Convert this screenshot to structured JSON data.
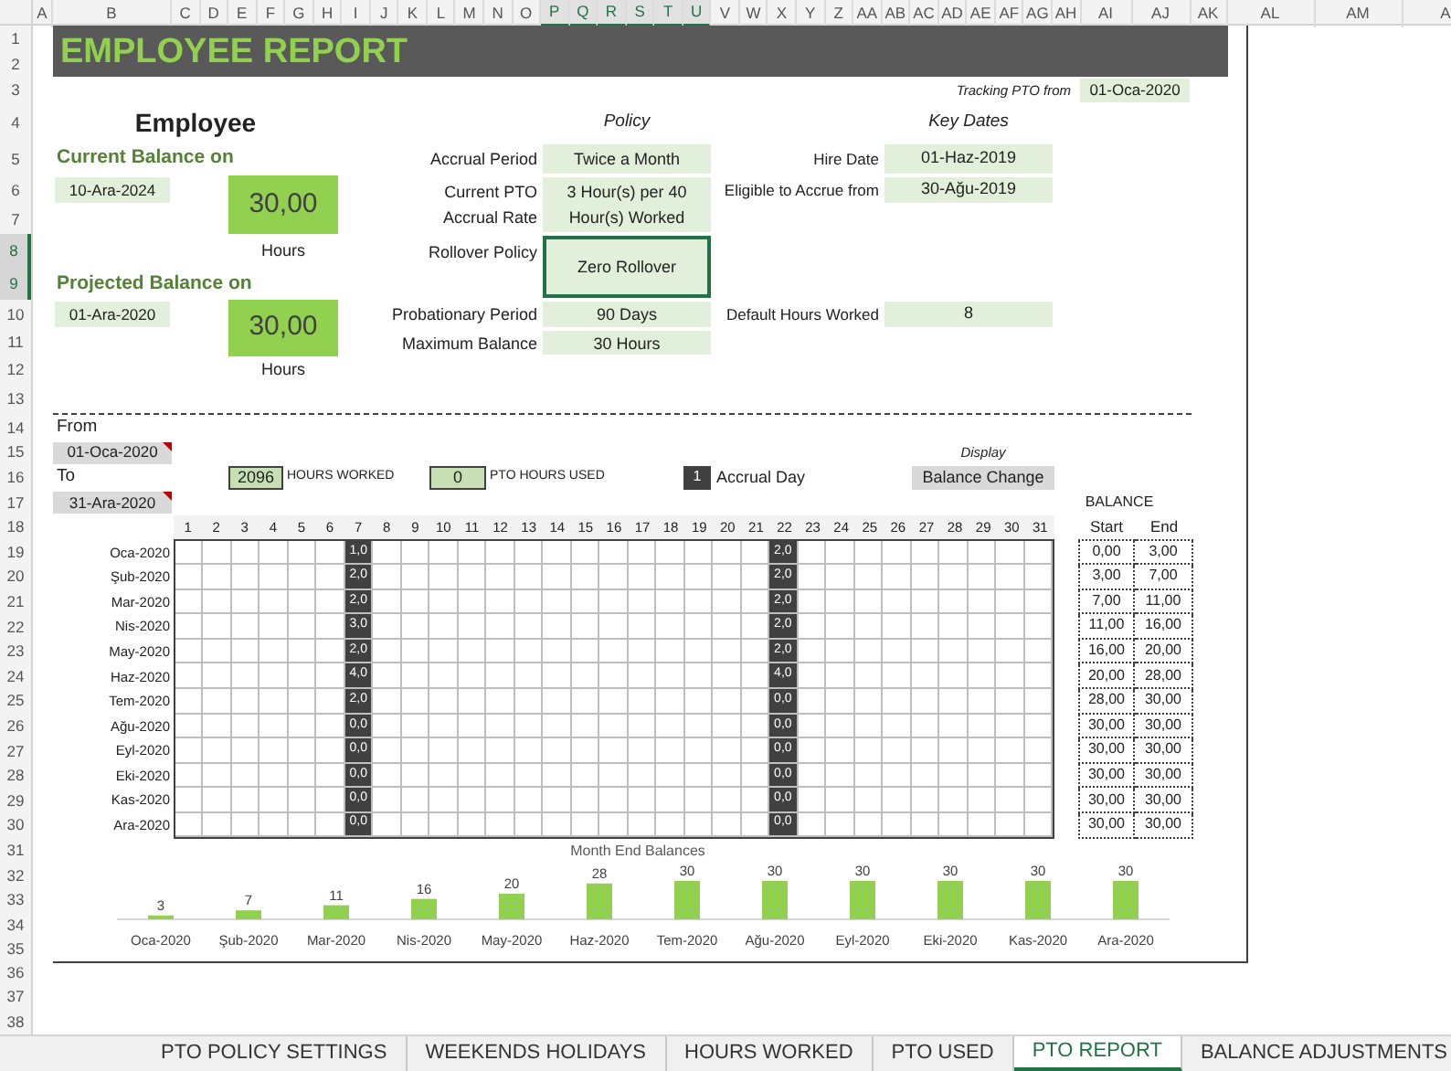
{
  "column_headers": [
    {
      "label": "A",
      "selected": false
    },
    {
      "label": "B",
      "selected": false
    },
    {
      "label": "C",
      "selected": false
    },
    {
      "label": "D",
      "selected": false
    },
    {
      "label": "E",
      "selected": false
    },
    {
      "label": "F",
      "selected": false
    },
    {
      "label": "G",
      "selected": false
    },
    {
      "label": "H",
      "selected": false
    },
    {
      "label": "I",
      "selected": false
    },
    {
      "label": "J",
      "selected": false
    },
    {
      "label": "K",
      "selected": false
    },
    {
      "label": "L",
      "selected": false
    },
    {
      "label": "M",
      "selected": false
    },
    {
      "label": "N",
      "selected": false
    },
    {
      "label": "O",
      "selected": false
    },
    {
      "label": "P",
      "selected": true
    },
    {
      "label": "Q",
      "selected": true
    },
    {
      "label": "R",
      "selected": true
    },
    {
      "label": "S",
      "selected": true
    },
    {
      "label": "T",
      "selected": true
    },
    {
      "label": "U",
      "selected": true
    },
    {
      "label": "V",
      "selected": false
    },
    {
      "label": "W",
      "selected": false
    },
    {
      "label": "X",
      "selected": false
    },
    {
      "label": "Y",
      "selected": false
    },
    {
      "label": "Z",
      "selected": false
    },
    {
      "label": "AA",
      "selected": false
    },
    {
      "label": "AB",
      "selected": false
    },
    {
      "label": "AC",
      "selected": false
    },
    {
      "label": "AD",
      "selected": false
    },
    {
      "label": "AE",
      "selected": false
    },
    {
      "label": "AF",
      "selected": false
    },
    {
      "label": "AG",
      "selected": false
    },
    {
      "label": "AH",
      "selected": false
    },
    {
      "label": "AI",
      "selected": false
    },
    {
      "label": "AJ",
      "selected": false
    },
    {
      "label": "AK",
      "selected": false
    },
    {
      "label": "AL",
      "selected": false
    },
    {
      "label": "AM",
      "selected": false
    },
    {
      "label": "A",
      "selected": false
    }
  ],
  "row_headers": [
    {
      "label": "1",
      "selected": false
    },
    {
      "label": "2",
      "selected": false
    },
    {
      "label": "3",
      "selected": false
    },
    {
      "label": "4",
      "selected": false
    },
    {
      "label": "5",
      "selected": false
    },
    {
      "label": "6",
      "selected": false
    },
    {
      "label": "7",
      "selected": false
    },
    {
      "label": "8",
      "selected": true
    },
    {
      "label": "9",
      "selected": true
    },
    {
      "label": "10",
      "selected": false
    },
    {
      "label": "11",
      "selected": false
    },
    {
      "label": "12",
      "selected": false
    },
    {
      "label": "13",
      "selected": false
    },
    {
      "label": "14",
      "selected": false
    },
    {
      "label": "15",
      "selected": false
    },
    {
      "label": "16",
      "selected": false
    },
    {
      "label": "17",
      "selected": false
    },
    {
      "label": "18",
      "selected": false
    },
    {
      "label": "19",
      "selected": false
    },
    {
      "label": "20",
      "selected": false
    },
    {
      "label": "21",
      "selected": false
    },
    {
      "label": "22",
      "selected": false
    },
    {
      "label": "23",
      "selected": false
    },
    {
      "label": "24",
      "selected": false
    },
    {
      "label": "25",
      "selected": false
    },
    {
      "label": "26",
      "selected": false
    },
    {
      "label": "27",
      "selected": false
    },
    {
      "label": "28",
      "selected": false
    },
    {
      "label": "29",
      "selected": false
    },
    {
      "label": "30",
      "selected": false
    },
    {
      "label": "31",
      "selected": false
    },
    {
      "label": "32",
      "selected": false
    },
    {
      "label": "33",
      "selected": false
    },
    {
      "label": "34",
      "selected": false
    },
    {
      "label": "35",
      "selected": false
    },
    {
      "label": "36",
      "selected": false
    },
    {
      "label": "37",
      "selected": false
    },
    {
      "label": "38",
      "selected": false
    }
  ],
  "report": {
    "title": "EMPLOYEE REPORT",
    "tracking": {
      "label": "Tracking PTO from",
      "value": "01-Oca-2020"
    },
    "employee": {
      "heading": "Employee",
      "balances": [
        {
          "label": "Current Balance on",
          "date": "10-Ara-2024",
          "value": "30,00",
          "unit": "Hours"
        },
        {
          "label": "Projected Balance on",
          "date": "01-Ara-2020",
          "value": "30,00",
          "unit": "Hours"
        }
      ]
    },
    "policy": {
      "heading": "Policy",
      "items": [
        {
          "label": "Accrual Period",
          "value": "Twice a Month",
          "selected": false
        },
        {
          "label": "Current PTO Accrual Rate",
          "value": "3 Hour(s) per 40 Hour(s) Worked",
          "selected": false
        },
        {
          "label": "Rollover Policy",
          "value": "Zero Rollover",
          "selected": true
        },
        {
          "label": "Probationary Period",
          "value": "90 Days",
          "selected": false
        },
        {
          "label": "Maximum Balance",
          "value": "30 Hours",
          "selected": false
        }
      ]
    },
    "key_dates": {
      "heading": "Key Dates",
      "items": [
        {
          "label": "Hire Date",
          "value": "01-Haz-2019"
        },
        {
          "label": "Eligible to Accrue from",
          "value": "30-Ağu-2019"
        },
        {
          "label": "Default Hours Worked",
          "value": "8"
        }
      ]
    },
    "period": {
      "from_label": "From",
      "from": "01-Oca-2020",
      "to_label": "To",
      "to": "31-Ara-2020"
    },
    "summary": {
      "hours_worked": "2096",
      "hours_worked_label": "HOURS WORKED",
      "pto_used": "0",
      "pto_used_label": "PTO HOURS USED",
      "accrual_key": "1",
      "accrual_key_label": "Accrual Day",
      "display_label": "Display",
      "display_value": "Balance Change"
    },
    "balance": {
      "heading": "BALANCE",
      "start_label": "Start",
      "end_label": "End"
    },
    "calendar": {
      "days": [
        {
          "label": "1",
          "accrual": false
        },
        {
          "label": "2",
          "accrual": false
        },
        {
          "label": "3",
          "accrual": false
        },
        {
          "label": "4",
          "accrual": false
        },
        {
          "label": "5",
          "accrual": false
        },
        {
          "label": "6",
          "accrual": false
        },
        {
          "label": "7",
          "accrual": true
        },
        {
          "label": "8",
          "accrual": false
        },
        {
          "label": "9",
          "accrual": false
        },
        {
          "label": "10",
          "accrual": false
        },
        {
          "label": "11",
          "accrual": false
        },
        {
          "label": "12",
          "accrual": false
        },
        {
          "label": "13",
          "accrual": false
        },
        {
          "label": "14",
          "accrual": false
        },
        {
          "label": "15",
          "accrual": false
        },
        {
          "label": "16",
          "accrual": false
        },
        {
          "label": "17",
          "accrual": false
        },
        {
          "label": "18",
          "accrual": false
        },
        {
          "label": "19",
          "accrual": false
        },
        {
          "label": "20",
          "accrual": false
        },
        {
          "label": "21",
          "accrual": false
        },
        {
          "label": "22",
          "accrual": true
        },
        {
          "label": "23",
          "accrual": false
        },
        {
          "label": "24",
          "accrual": false
        },
        {
          "label": "25",
          "accrual": false
        },
        {
          "label": "26",
          "accrual": false
        },
        {
          "label": "27",
          "accrual": false
        },
        {
          "label": "28",
          "accrual": false
        },
        {
          "label": "29",
          "accrual": false
        },
        {
          "label": "30",
          "accrual": false
        },
        {
          "label": "31",
          "accrual": false
        }
      ],
      "months": [
        {
          "label": "Oca-2020",
          "accruals": [
            "1,0",
            "2,0"
          ],
          "start": "0,00",
          "end": "3,00"
        },
        {
          "label": "Şub-2020",
          "accruals": [
            "2,0",
            "2,0"
          ],
          "start": "3,00",
          "end": "7,00"
        },
        {
          "label": "Mar-2020",
          "accruals": [
            "2,0",
            "2,0"
          ],
          "start": "7,00",
          "end": "11,00"
        },
        {
          "label": "Nis-2020",
          "accruals": [
            "3,0",
            "2,0"
          ],
          "start": "11,00",
          "end": "16,00"
        },
        {
          "label": "May-2020",
          "accruals": [
            "2,0",
            "2,0"
          ],
          "start": "16,00",
          "end": "20,00"
        },
        {
          "label": "Haz-2020",
          "accruals": [
            "4,0",
            "4,0"
          ],
          "start": "20,00",
          "end": "28,00"
        },
        {
          "label": "Tem-2020",
          "accruals": [
            "2,0",
            "0,0"
          ],
          "start": "28,00",
          "end": "30,00"
        },
        {
          "label": "Ağu-2020",
          "accruals": [
            "0,0",
            "0,0"
          ],
          "start": "30,00",
          "end": "30,00"
        },
        {
          "label": "Eyl-2020",
          "accruals": [
            "0,0",
            "0,0"
          ],
          "start": "30,00",
          "end": "30,00"
        },
        {
          "label": "Eki-2020",
          "accruals": [
            "0,0",
            "0,0"
          ],
          "start": "30,00",
          "end": "30,00"
        },
        {
          "label": "Kas-2020",
          "accruals": [
            "0,0",
            "0,0"
          ],
          "start": "30,00",
          "end": "30,00"
        },
        {
          "label": "Ara-2020",
          "accruals": [
            "0,0",
            "0,0"
          ],
          "start": "30,00",
          "end": "30,00"
        }
      ]
    },
    "chart_data": {
      "type": "bar",
      "title": "Month End Balances",
      "categories": [
        "Oca-2020",
        "Şub-2020",
        "Mar-2020",
        "Nis-2020",
        "May-2020",
        "Haz-2020",
        "Tem-2020",
        "Ağu-2020",
        "Eyl-2020",
        "Eki-2020",
        "Kas-2020",
        "Ara-2020"
      ],
      "values": [
        3,
        7,
        11,
        16,
        20,
        28,
        30,
        30,
        30,
        30,
        30,
        30
      ],
      "data_labels": true
    }
  },
  "sheet_tabs": [
    {
      "label": "PTO POLICY SETTINGS",
      "selected": false
    },
    {
      "label": "WEEKENDS HOLIDAYS",
      "selected": false
    },
    {
      "label": "HOURS WORKED",
      "selected": false
    },
    {
      "label": "PTO USED",
      "selected": false
    },
    {
      "label": "PTO REPORT",
      "selected": true
    },
    {
      "label": "BALANCE ADJUSTMENTS",
      "selected": false
    }
  ]
}
